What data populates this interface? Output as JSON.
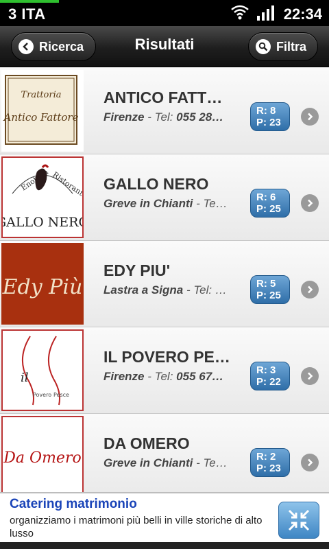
{
  "status_bar": {
    "carrier": "3 ITA",
    "time": "22:34",
    "load_progress": 0.18
  },
  "header": {
    "back_label": "Ricerca",
    "title": "Risultati",
    "filter_label": "Filtra"
  },
  "results": [
    {
      "name": "ANTICO FATT…",
      "city": "Firenze",
      "tel_label": "Tel:",
      "tel": "055 28…",
      "rating": "R: 8",
      "price": "P: 23",
      "logo_text": [
        "Trattoria",
        "Antico Fattore"
      ]
    },
    {
      "name": "GALLO NERO",
      "city": "Greve in Chianti",
      "tel_label": "Te…",
      "tel": "",
      "rating": "R: 6",
      "price": "P: 25",
      "logo_text": [
        "Enoteca",
        "Ristorante",
        "GALLO NERO"
      ]
    },
    {
      "name": "EDY PIU'",
      "city": "Lastra a Signa",
      "tel_label": "Tel: …",
      "tel": "",
      "rating": "R: 5",
      "price": "P: 25",
      "logo_text": [
        "Edy Più"
      ]
    },
    {
      "name": "IL POVERO PE…",
      "city": "Firenze",
      "tel_label": "Tel:",
      "tel": "055 67…",
      "rating": "R: 3",
      "price": "P: 22",
      "logo_text": [
        "il",
        "Povero",
        "Pesce"
      ]
    },
    {
      "name": "DA OMERO",
      "city": "Greve in Chianti",
      "tel_label": "Te…",
      "tel": "",
      "rating": "R: 2",
      "price": "P: 23",
      "logo_text": [
        "Da Omero"
      ]
    }
  ],
  "ad": {
    "title": "Catering matrimonio",
    "text": "organizziamo i matrimoni più belli in ville storiche di alto lusso"
  },
  "colors": {
    "badge": "#3f7fbf",
    "ad_title": "#1a44b8",
    "status_progress": "#2fbf2f"
  }
}
